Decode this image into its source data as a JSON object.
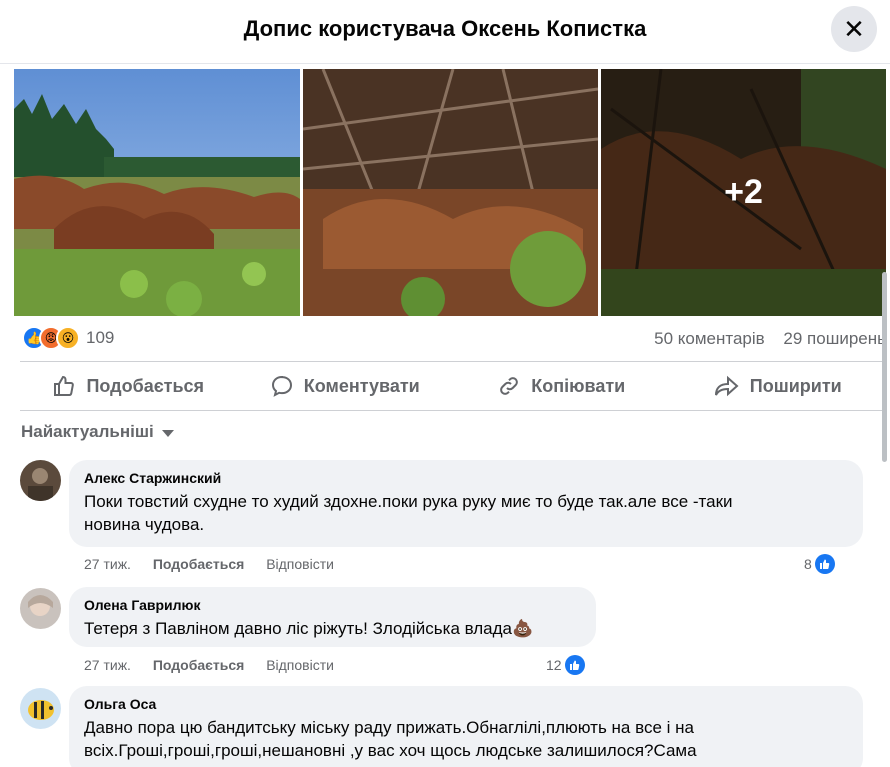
{
  "header": {
    "title": "Допис користувача Оксень Копистка",
    "close_icon": "close-icon"
  },
  "photos": {
    "more_label": "+2"
  },
  "stats": {
    "reactions": [
      "like",
      "angry",
      "wow"
    ],
    "reaction_count": "109",
    "comments": "50 коментарів",
    "shares": "29 поширень"
  },
  "actions": {
    "like": "Подобається",
    "comment": "Коментувати",
    "copy": "Копіювати",
    "share": "Поширити"
  },
  "sort": {
    "label": "Найактуальніші"
  },
  "comments": [
    {
      "author": "Алекс Старжинский",
      "text_line1": "Поки товстий схудне то худий здохне.поки рука руку миє то буде так.але все -таки",
      "text_line2": "новина чудова.",
      "time": "27 тиж.",
      "like": "Подобається",
      "reply": "Відповісти",
      "likes": "8"
    },
    {
      "author": "Олена Гаврилюк",
      "text": "Тетеря з Павліном давно ліс ріжуть! Злодійська влада",
      "emoji": "💩",
      "time": "27 тиж.",
      "like": "Подобається",
      "reply": "Відповісти",
      "likes": "12"
    },
    {
      "author": "Ольга Оса",
      "text_line1": "Давно пора цю бандитську міську раду прижать.Обнаглілі,плюють на все і на",
      "text_line2": "всіх.Гроші,гроші,гроші,нешановні ,у вас хоч щось людське залишилося?Сама"
    }
  ],
  "colors": {
    "accent": "#1877f2",
    "muted": "#65676b",
    "bubble": "#f0f2f5"
  }
}
